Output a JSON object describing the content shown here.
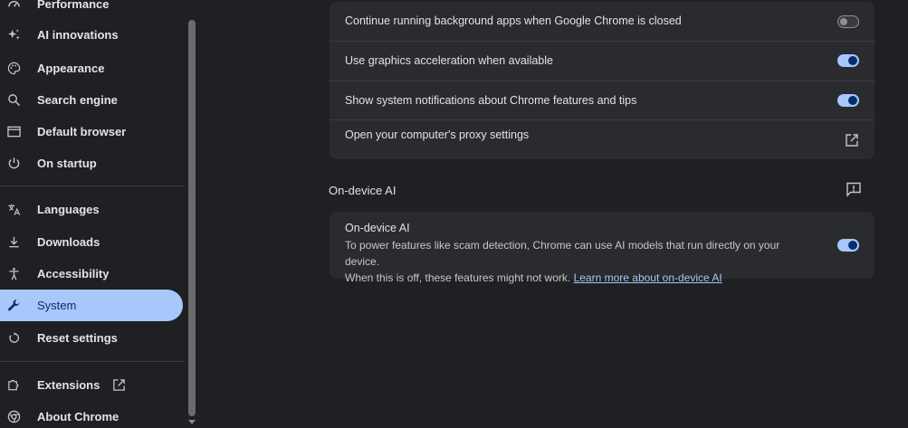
{
  "sidebar": {
    "items": [
      {
        "label": "Performance",
        "icon": "performance-icon"
      },
      {
        "label": "AI innovations",
        "icon": "sparkle-icon"
      },
      {
        "label": "Appearance",
        "icon": "palette-icon"
      },
      {
        "label": "Search engine",
        "icon": "search-icon"
      },
      {
        "label": "Default browser",
        "icon": "browser-window-icon"
      },
      {
        "label": "On startup",
        "icon": "power-icon"
      },
      {
        "label": "Languages",
        "icon": "translate-icon"
      },
      {
        "label": "Downloads",
        "icon": "download-icon"
      },
      {
        "label": "Accessibility",
        "icon": "accessibility-icon"
      },
      {
        "label": "System",
        "icon": "wrench-icon",
        "active": true
      },
      {
        "label": "Reset settings",
        "icon": "reset-icon"
      },
      {
        "label": "Extensions",
        "icon": "puzzle-icon"
      },
      {
        "label": "About Chrome",
        "icon": "chrome-icon"
      }
    ]
  },
  "system_card": {
    "rows": [
      {
        "label": "Continue running background apps when Google Chrome is closed",
        "control": "toggle",
        "checked": false
      },
      {
        "label": "Use graphics acceleration when available",
        "control": "toggle",
        "checked": true
      },
      {
        "label": "Show system notifications about Chrome features and tips",
        "control": "toggle",
        "checked": true
      },
      {
        "label": "Open your computer's proxy settings",
        "control": "launch-icon"
      }
    ]
  },
  "on_device_ai": {
    "section_title": "On-device AI",
    "row_title": "On-device AI",
    "description_line1": "To power features like scam detection, Chrome can use AI models that run directly on your device.",
    "description_line2": "When this is off, these features might not work.",
    "learn_more": "Learn more about on-device AI",
    "checked": true
  },
  "colors": {
    "accent": "#a8c7fa",
    "accent_dark": "#062e6f",
    "background": "#1f2023",
    "card": "#2a2b2e"
  }
}
